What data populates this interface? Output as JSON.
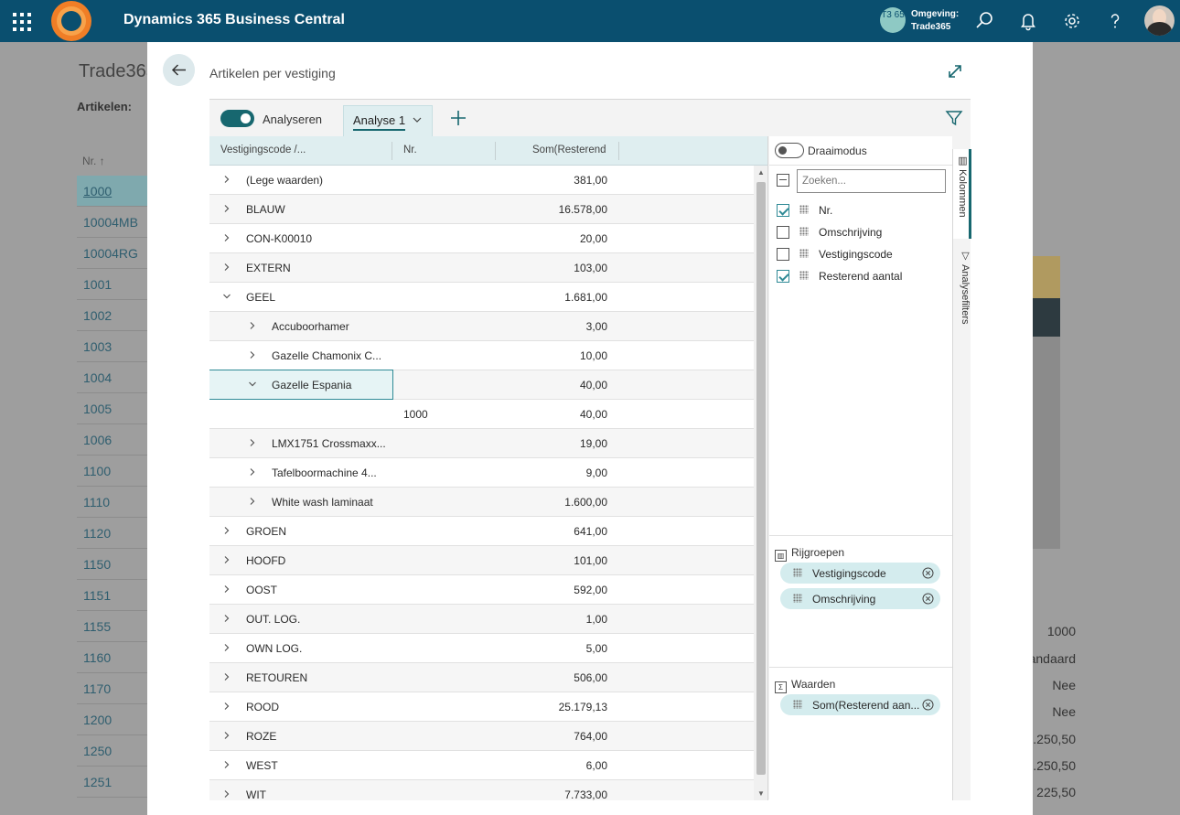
{
  "app": {
    "title": "Dynamics 365 Business Central",
    "env_badge": "T3 65",
    "env_label": "Omgeving:",
    "env_name": "Trade365"
  },
  "background": {
    "title": "Trade365",
    "list_label": "Artikelen:",
    "column": "Nr. ↑",
    "items": [
      "1000",
      "10004MB",
      "10004RG",
      "1001",
      "1002",
      "1003",
      "1004",
      "1005",
      "1006",
      "1100",
      "1110",
      "1120",
      "1150",
      "1151",
      "1155",
      "1160",
      "1170",
      "1200",
      "1250",
      "1251"
    ],
    "right_values": [
      "1000",
      "andaard",
      "Nee",
      "Nee",
      "1.250,50",
      "1.250,50",
      "225,50"
    ]
  },
  "dialog": {
    "title": "Artikelen per vestiging",
    "toggle_label": "Analyseren",
    "tab_label": "Analyse 1",
    "columns": {
      "c1": "Vestigingscode /...",
      "c2": "Nr.",
      "c3": "Som(Resterend"
    },
    "rows": [
      {
        "level": 0,
        "expanded": false,
        "label": "(Lege waarden)",
        "nr": "",
        "value": "381,00"
      },
      {
        "level": 0,
        "expanded": false,
        "label": "BLAUW",
        "nr": "",
        "value": "16.578,00"
      },
      {
        "level": 0,
        "expanded": false,
        "label": "CON-K00010",
        "nr": "",
        "value": "20,00"
      },
      {
        "level": 0,
        "expanded": false,
        "label": "EXTERN",
        "nr": "",
        "value": "103,00"
      },
      {
        "level": 0,
        "expanded": true,
        "label": "GEEL",
        "nr": "",
        "value": "1.681,00"
      },
      {
        "level": 1,
        "expanded": false,
        "label": "Accuboorhamer",
        "nr": "",
        "value": "3,00"
      },
      {
        "level": 1,
        "expanded": false,
        "label": "Gazelle Chamonix C...",
        "nr": "",
        "value": "10,00"
      },
      {
        "level": 1,
        "expanded": true,
        "label": "Gazelle Espania",
        "nr": "",
        "value": "40,00",
        "selected": true
      },
      {
        "level": 2,
        "expanded": null,
        "label": "",
        "nr": "1000",
        "value": "40,00"
      },
      {
        "level": 1,
        "expanded": false,
        "label": "LMX1751 Crossmaxx...",
        "nr": "",
        "value": "19,00"
      },
      {
        "level": 1,
        "expanded": false,
        "label": "Tafelboormachine 4...",
        "nr": "",
        "value": "9,00"
      },
      {
        "level": 1,
        "expanded": false,
        "label": "White wash laminaat",
        "nr": "",
        "value": "1.600,00"
      },
      {
        "level": 0,
        "expanded": false,
        "label": "GROEN",
        "nr": "",
        "value": "641,00"
      },
      {
        "level": 0,
        "expanded": false,
        "label": "HOOFD",
        "nr": "",
        "value": "101,00"
      },
      {
        "level": 0,
        "expanded": false,
        "label": "OOST",
        "nr": "",
        "value": "592,00"
      },
      {
        "level": 0,
        "expanded": false,
        "label": "OUT. LOG.",
        "nr": "",
        "value": "1,00"
      },
      {
        "level": 0,
        "expanded": false,
        "label": "OWN LOG.",
        "nr": "",
        "value": "5,00"
      },
      {
        "level": 0,
        "expanded": false,
        "label": "RETOUREN",
        "nr": "",
        "value": "506,00"
      },
      {
        "level": 0,
        "expanded": false,
        "label": "ROOD",
        "nr": "",
        "value": "25.179,13"
      },
      {
        "level": 0,
        "expanded": false,
        "label": "ROZE",
        "nr": "",
        "value": "764,00"
      },
      {
        "level": 0,
        "expanded": false,
        "label": "WEST",
        "nr": "",
        "value": "6,00"
      },
      {
        "level": 0,
        "expanded": false,
        "label": "WIT",
        "nr": "",
        "value": "7.733,00"
      }
    ]
  },
  "panel": {
    "pivot_label": "Draaimodus",
    "search_placeholder": "Zoeken...",
    "fields": [
      {
        "label": "Nr.",
        "checked": true
      },
      {
        "label": "Omschrijving",
        "checked": false
      },
      {
        "label": "Vestigingscode",
        "checked": false
      },
      {
        "label": "Resterend aantal",
        "checked": true
      }
    ],
    "row_groups_title": "Rijgroepen",
    "row_groups": [
      "Vestigingscode",
      "Omschrijving"
    ],
    "values_title": "Waarden",
    "values": [
      "Som(Resterend aan..."
    ],
    "tab_columns": "Kolommen",
    "tab_filters": "Analysefilters"
  },
  "colors": {
    "topbar": "#0a4f6f",
    "accent": "#17676f",
    "header_bg": "#dfeef0"
  }
}
